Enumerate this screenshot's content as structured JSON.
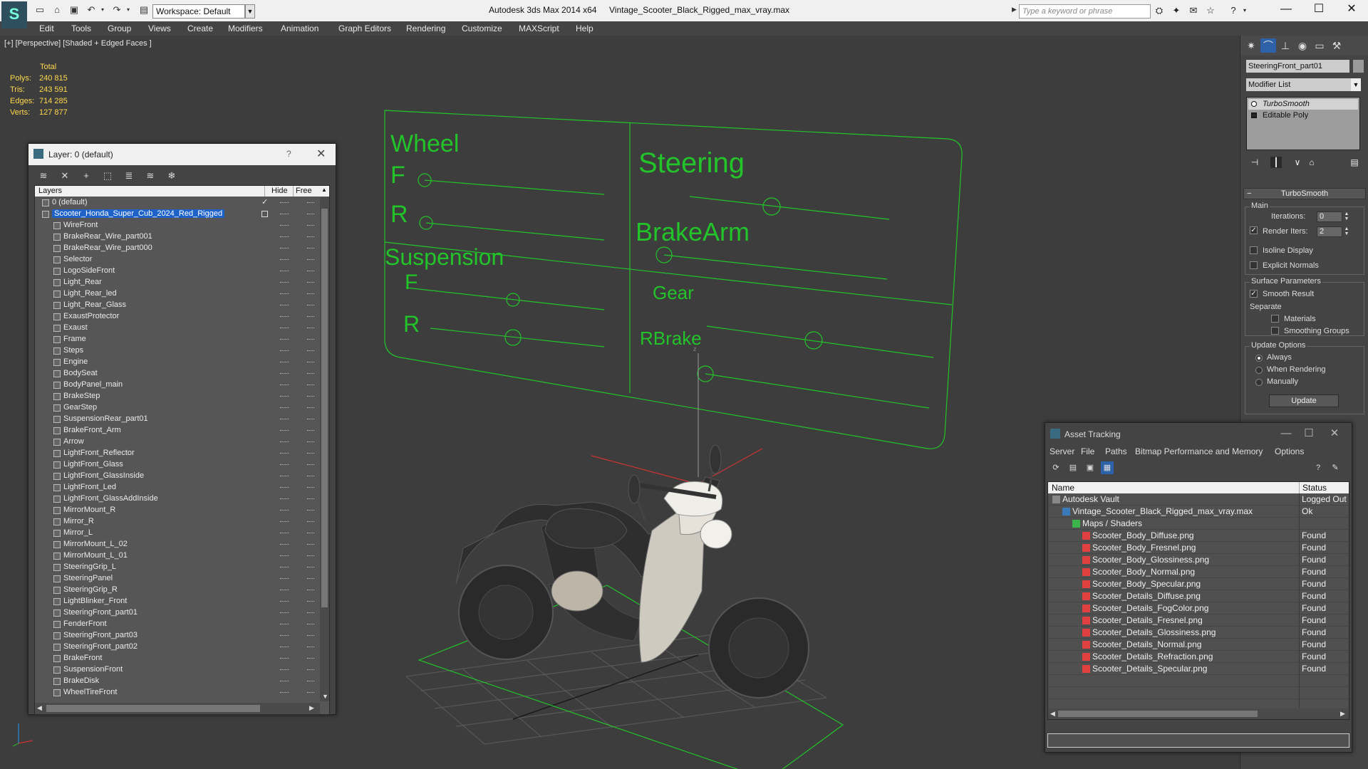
{
  "titlebar": {
    "app_title": "Autodesk 3ds Max  2014 x64",
    "file_title": "Vintage_Scooter_Black_Rigged_max_vray.max",
    "workspace": "Workspace: Default",
    "search_placeholder": "Type a keyword or phrase"
  },
  "menu": [
    "Edit",
    "Tools",
    "Group",
    "Views",
    "Create",
    "Modifiers",
    "Animation",
    "Graph Editors",
    "Rendering",
    "Customize",
    "MAXScript",
    "Help"
  ],
  "viewport": {
    "label": "[+] [Perspective] [Shaded + Edged Faces ]",
    "stats_header": "Total",
    "stats": [
      {
        "label": "Polys:",
        "value": "240 815"
      },
      {
        "label": "Tris:",
        "value": "243 591"
      },
      {
        "label": "Edges:",
        "value": "714 285"
      },
      {
        "label": "Verts:",
        "value": "127 877"
      }
    ],
    "rig_labels": {
      "wheel": "Wheel",
      "wheel_f": "F",
      "wheel_r": "R",
      "steering": "Steering",
      "brakearm": "BrakeArm",
      "suspension": "Suspension",
      "susp_f": "F",
      "susp_r": "R",
      "gear": "Gear",
      "rbrake": "RBrake"
    },
    "rig_color": "#22c42a"
  },
  "layer_dialog": {
    "title": "Layer: 0 (default)",
    "help": "?",
    "columns": {
      "layers": "Layers",
      "hide": "Hide",
      "freeze": "Free"
    },
    "default_layer": "0 (default)",
    "selected_layer": "Scooter_Honda_Super_Cub_2024_Red_Rigged",
    "objects": [
      "WireFront",
      "BrakeRear_Wire_part001",
      "BrakeRear_Wire_part000",
      "Selector",
      "LogoSideFront",
      "Light_Rear",
      "Light_Rear_led",
      "Light_Rear_Glass",
      "ExaustProtector",
      "Exaust",
      "Frame",
      "Steps",
      "Engine",
      "BodySeat",
      "BodyPanel_main",
      "BrakeStep",
      "GearStep",
      "SuspensionRear_part01",
      "BrakeFront_Arm",
      "Arrow",
      "LightFront_Reflector",
      "LightFront_Glass",
      "LightFront_GlassInside",
      "LightFront_Led",
      "LightFront_GlassAddInside",
      "MirrorMount_R",
      "Mirror_R",
      "Mirror_L",
      "MirrorMount_L_02",
      "MirrorMount_L_01",
      "SteeringGrip_L",
      "SteeringPanel",
      "SteeringGrip_R",
      "LightBlinker_Front",
      "SteeringFront_part01",
      "FenderFront",
      "SteeringFront_part03",
      "SteeringFront_part02",
      "BrakeFront",
      "SuspensionFront",
      "BrakeDisk",
      "WheelTireFront"
    ]
  },
  "command_panel": {
    "object_name": "SteeringFront_part01",
    "modifier_list": "Modifier List",
    "stack": [
      "TurboSmooth",
      "Editable Poly"
    ],
    "rollout_title": "TurboSmooth",
    "main_group": "Main",
    "iterations_label": "Iterations:",
    "iterations_value": "0",
    "render_iters_label": "Render Iters:",
    "render_iters_value": "2",
    "isoline": "Isoline Display",
    "explicit_normals": "Explicit Normals",
    "surface_group": "Surface Parameters",
    "smooth_result": "Smooth Result",
    "separate": "Separate",
    "materials": "Materials",
    "smoothing_groups": "Smoothing Groups",
    "update_group": "Update Options",
    "always": "Always",
    "when_rendering": "When Rendering",
    "manually": "Manually",
    "update_button": "Update"
  },
  "asset_tracking": {
    "title": "Asset Tracking",
    "menu": [
      "Server",
      "File",
      "Paths",
      "Bitmap Performance and Memory",
      "Options"
    ],
    "columns": {
      "name": "Name",
      "status": "Status"
    },
    "rows": [
      {
        "name": "Autodesk Vault",
        "status": "Logged Out",
        "level": 0,
        "icon": "vault-icon"
      },
      {
        "name": "Vintage_Scooter_Black_Rigged_max_vray.max",
        "status": "Ok",
        "level": 1,
        "icon": "max-file-icon"
      },
      {
        "name": "Maps / Shaders",
        "status": "",
        "level": 2,
        "icon": "maps-folder-icon"
      },
      {
        "name": "Scooter_Body_Diffuse.png",
        "status": "Found",
        "level": 3,
        "icon": "png-icon"
      },
      {
        "name": "Scooter_Body_Fresnel.png",
        "status": "Found",
        "level": 3,
        "icon": "png-icon"
      },
      {
        "name": "Scooter_Body_Glossiness.png",
        "status": "Found",
        "level": 3,
        "icon": "png-icon"
      },
      {
        "name": "Scooter_Body_Normal.png",
        "status": "Found",
        "level": 3,
        "icon": "png-icon"
      },
      {
        "name": "Scooter_Body_Specular.png",
        "status": "Found",
        "level": 3,
        "icon": "png-icon"
      },
      {
        "name": "Scooter_Details_Diffuse.png",
        "status": "Found",
        "level": 3,
        "icon": "png-icon"
      },
      {
        "name": "Scooter_Details_FogColor.png",
        "status": "Found",
        "level": 3,
        "icon": "png-icon"
      },
      {
        "name": "Scooter_Details_Fresnel.png",
        "status": "Found",
        "level": 3,
        "icon": "png-icon"
      },
      {
        "name": "Scooter_Details_Glossiness.png",
        "status": "Found",
        "level": 3,
        "icon": "png-icon"
      },
      {
        "name": "Scooter_Details_Normal.png",
        "status": "Found",
        "level": 3,
        "icon": "png-icon"
      },
      {
        "name": "Scooter_Details_Refraction.png",
        "status": "Found",
        "level": 3,
        "icon": "png-icon"
      },
      {
        "name": "Scooter_Details_Specular.png",
        "status": "Found",
        "level": 3,
        "icon": "png-icon"
      }
    ]
  }
}
